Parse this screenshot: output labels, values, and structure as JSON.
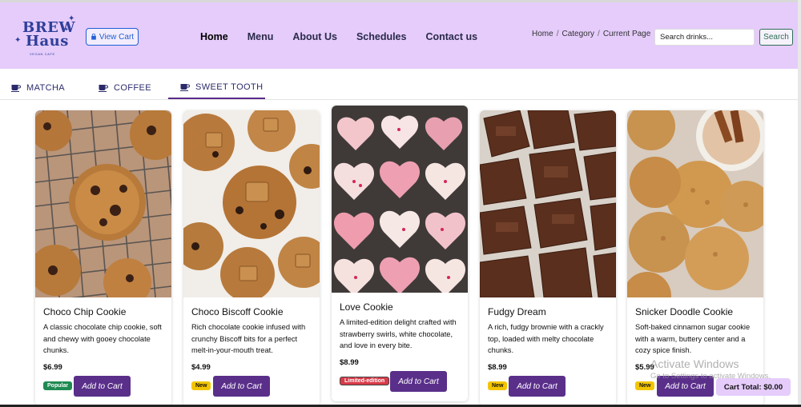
{
  "brand": {
    "line1": "BREW",
    "line2": "Haus",
    "tagline": "VEGAN CAFE",
    "color": "#2f3f9a"
  },
  "header": {
    "view_cart_label": "View Cart",
    "nav": [
      {
        "label": "Home",
        "active": true
      },
      {
        "label": "Menu"
      },
      {
        "label": "About Us"
      },
      {
        "label": "Schedules"
      },
      {
        "label": "Contact us"
      }
    ],
    "breadcrumb": [
      "Home",
      "Category",
      "Current Page"
    ],
    "breadcrumb_sep": "/",
    "search_placeholder": "Search drinks...",
    "search_button": "Search",
    "background": "#e5ccfb"
  },
  "tabs": [
    {
      "label": "MATCHA",
      "icon": "cup-icon"
    },
    {
      "label": "COFFEE",
      "icon": "cup-icon"
    },
    {
      "label": "SWEET TOOTH",
      "icon": "cup-icon",
      "active": true
    }
  ],
  "products": [
    {
      "name": "Choco Chip Cookie",
      "description": "A classic chocolate chip cookie, soft and chewy with gooey chocolate chunks.",
      "price": "$6.99",
      "badge": "Popular",
      "badge_type": "popular",
      "button": "Add to Cart",
      "image": "choco-chip-cookies-on-rack"
    },
    {
      "name": "Choco Biscoff Cookie",
      "description": "Rich chocolate cookie infused with crunchy Biscoff bits for a perfect melt-in-your-mouth treat.",
      "price": "$4.99",
      "badge": "New",
      "badge_type": "new",
      "button": "Add to Cart",
      "image": "biscoff-cookies"
    },
    {
      "name": "Love Cookie",
      "description": "A limited-edition delight crafted with strawberry swirls, white chocolate, and love in every bite.",
      "price": "$8.99",
      "badge": "Limited-edition",
      "badge_type": "limited",
      "button": "Add to Cart",
      "image": "heart-cookies"
    },
    {
      "name": "Fudgy Dream",
      "description": "A rich, fudgy brownie with a crackly top, loaded with melty chocolate chunks.",
      "price": "$8.99",
      "badge": "New",
      "badge_type": "new",
      "button": "Add to Cart",
      "image": "brownies"
    },
    {
      "name": "Snicker Doodle Cookie",
      "description": "Soft-baked cinnamon sugar cookie with a warm, buttery center and a cozy spice finish.",
      "price": "$5.99",
      "badge": "New",
      "badge_type": "new",
      "button": "Add to Cart",
      "image": "snickerdoodle-cookies"
    }
  ],
  "cart_total": "Cart Total: $0.00",
  "watermark": {
    "line1": "Activate Windows",
    "line2": "Go to Settings to activate Windows."
  },
  "colors": {
    "accent": "#5a2f8a",
    "header_bg": "#e5ccfb",
    "badge_popular": "#1f8a52",
    "badge_new": "#f2c500",
    "badge_limited": "#d83b49"
  }
}
